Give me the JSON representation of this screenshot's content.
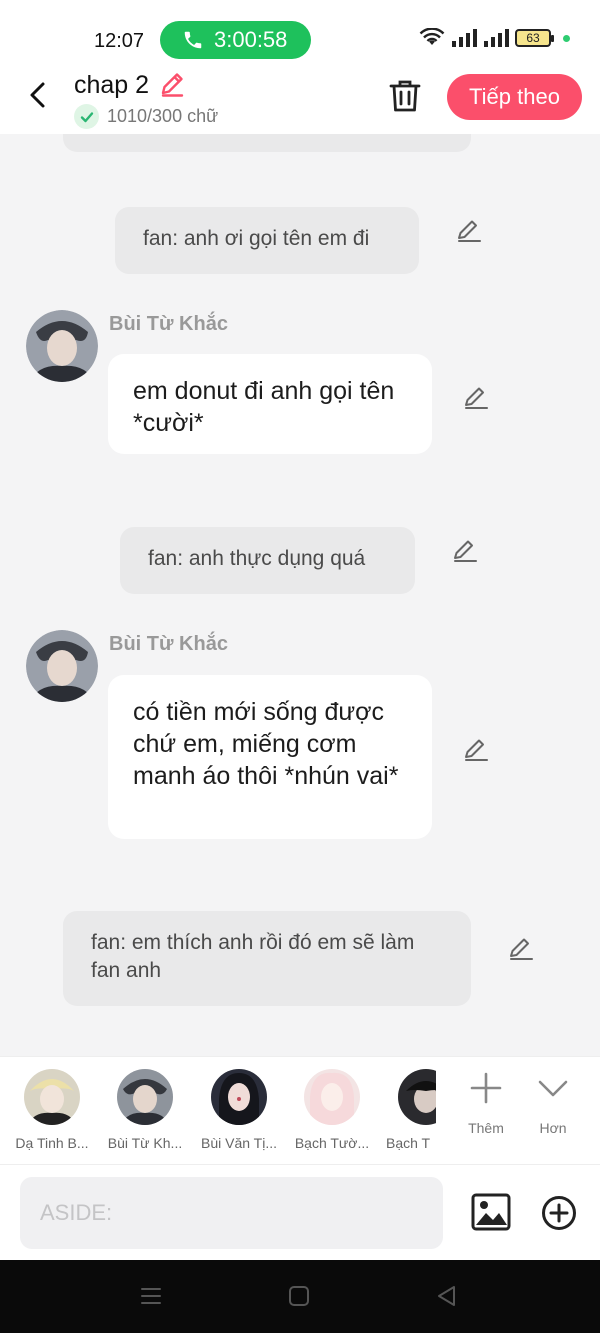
{
  "status_bar": {
    "time": "12:07",
    "call_duration": "3:00:58",
    "battery": "63"
  },
  "header": {
    "title": "chap 2",
    "word_count": "1010/300 chữ",
    "next_label": "Tiếp theo"
  },
  "messages": [
    {
      "type": "narration",
      "text": "fan: anh ơi gọi tên em đi"
    },
    {
      "type": "character",
      "speaker": "Bùi Từ Khắc",
      "text": "em donut đi anh gọi tên *cười*"
    },
    {
      "type": "narration",
      "text": "fan: anh thực dụng quá"
    },
    {
      "type": "character",
      "speaker": "Bùi Từ Khắc",
      "text": "có tiền mới sống được chứ em, miếng cơm manh áo thôi *nhún vai*"
    },
    {
      "type": "narration",
      "text": "fan: em thích anh rồi đó em sẽ làm fan anh"
    }
  ],
  "characters": [
    {
      "name": "Dạ Tinh B..."
    },
    {
      "name": "Bùi Từ Kh..."
    },
    {
      "name": "Bùi Văn Tị..."
    },
    {
      "name": "Bạch Tườ..."
    },
    {
      "name": "Bạch T"
    }
  ],
  "actions": {
    "add_label": "Thêm",
    "more_label": "Hơn"
  },
  "input": {
    "placeholder": "ASIDE:"
  },
  "colors": {
    "accent": "#fb4f6b",
    "call_green": "#1ec15c",
    "background": "#f4f4f5"
  }
}
